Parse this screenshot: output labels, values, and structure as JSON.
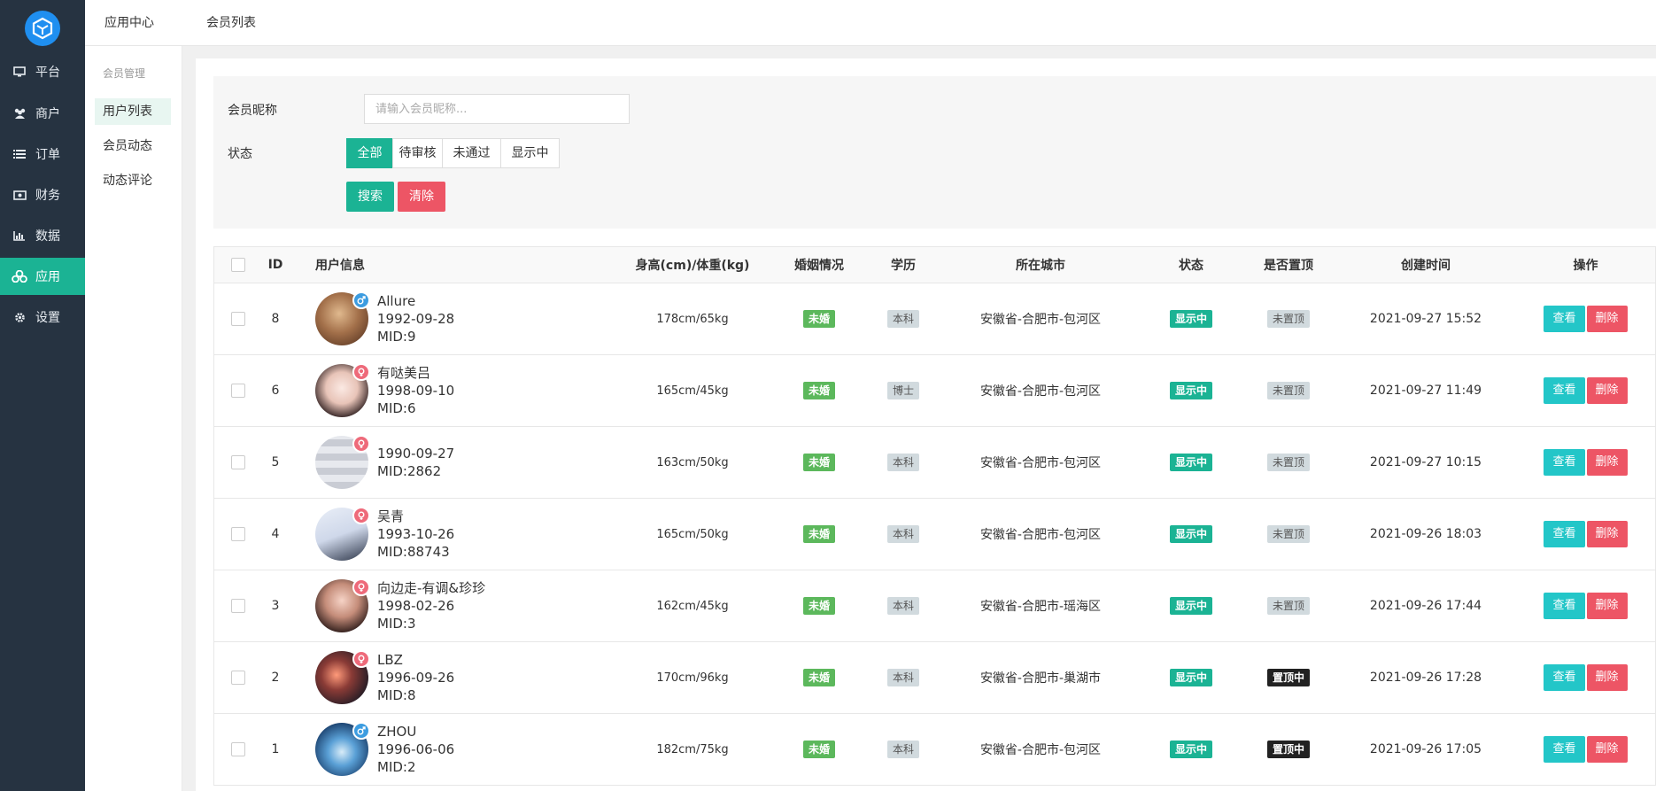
{
  "sidebar": {
    "items": [
      {
        "label": "平台",
        "icon": "monitor-icon",
        "active": false
      },
      {
        "label": "商户",
        "icon": "users-icon",
        "active": false
      },
      {
        "label": "订单",
        "icon": "list-icon",
        "active": false
      },
      {
        "label": "财务",
        "icon": "money-icon",
        "active": false
      },
      {
        "label": "数据",
        "icon": "bar-chart-icon",
        "active": false
      },
      {
        "label": "应用",
        "icon": "cubes-icon",
        "active": true
      },
      {
        "label": "设置",
        "icon": "gear-icon",
        "active": false
      }
    ]
  },
  "topbar": {
    "app_center": "应用中心",
    "member_list": "会员列表"
  },
  "submenu": {
    "title": "会员管理",
    "items": [
      {
        "label": "用户列表",
        "active": true
      },
      {
        "label": "会员动态",
        "active": false
      },
      {
        "label": "动态评论",
        "active": false
      }
    ]
  },
  "filter": {
    "nickname_label": "会员昵称",
    "nickname_placeholder": "请输入会员昵称...",
    "nickname_value": "",
    "status_label": "状态",
    "status_options": [
      "全部",
      "待审核",
      "未通过",
      "显示中"
    ],
    "status_selected": "全部",
    "search_button": "搜索",
    "clear_button": "清除"
  },
  "table": {
    "columns": {
      "id": "ID",
      "user": "用户信息",
      "body": "身高(cm)/体重(kg)",
      "marriage": "婚姻情况",
      "education": "学历",
      "city": "所在城市",
      "status": "状态",
      "pinned": "是否置顶",
      "created": "创建时间",
      "actions": "操作"
    },
    "rows": [
      {
        "id": "8",
        "name": "Allure",
        "birthday": "1992-09-28",
        "mid": "MID:9",
        "gender": "male",
        "body": "178cm/65kg",
        "marriage": "未婚",
        "education": "本科",
        "city": "安徽省-合肥市-包河区",
        "status": "显示中",
        "pinned": "未置顶",
        "created": "2021-09-27 15:52"
      },
      {
        "id": "6",
        "name": "有哒美吕",
        "birthday": "1998-09-10",
        "mid": "MID:6",
        "gender": "female",
        "body": "165cm/45kg",
        "marriage": "未婚",
        "education": "博士",
        "city": "安徽省-合肥市-包河区",
        "status": "显示中",
        "pinned": "未置顶",
        "created": "2021-09-27 11:49"
      },
      {
        "id": "5",
        "name": "",
        "birthday": "1990-09-27",
        "mid": "MID:2862",
        "gender": "female",
        "body": "163cm/50kg",
        "marriage": "未婚",
        "education": "本科",
        "city": "安徽省-合肥市-包河区",
        "status": "显示中",
        "pinned": "未置顶",
        "created": "2021-09-27 10:15"
      },
      {
        "id": "4",
        "name": "吴青",
        "birthday": "1993-10-26",
        "mid": "MID:88743",
        "gender": "female",
        "body": "165cm/50kg",
        "marriage": "未婚",
        "education": "本科",
        "city": "安徽省-合肥市-包河区",
        "status": "显示中",
        "pinned": "未置顶",
        "created": "2021-09-26 18:03"
      },
      {
        "id": "3",
        "name": "向边走-有调&珍珍",
        "birthday": "1998-02-26",
        "mid": "MID:3",
        "gender": "female",
        "body": "162cm/45kg",
        "marriage": "未婚",
        "education": "本科",
        "city": "安徽省-合肥市-瑶海区",
        "status": "显示中",
        "pinned": "未置顶",
        "created": "2021-09-26 17:44"
      },
      {
        "id": "2",
        "name": "LBZ",
        "birthday": "1996-09-26",
        "mid": "MID:8",
        "gender": "female",
        "body": "170cm/96kg",
        "marriage": "未婚",
        "education": "本科",
        "city": "安徽省-合肥市-巢湖市",
        "status": "显示中",
        "pinned": "置顶中",
        "created": "2021-09-26 17:28"
      },
      {
        "id": "1",
        "name": "ZHOU",
        "birthday": "1996-06-06",
        "mid": "MID:2",
        "gender": "male",
        "body": "182cm/75kg",
        "marriage": "未婚",
        "education": "本科",
        "city": "安徽省-合肥市-包河区",
        "status": "显示中",
        "pinned": "置顶中",
        "created": "2021-09-26 17:05"
      }
    ],
    "view_label": "查看",
    "delete_label": "删除"
  },
  "colors": {
    "sidebar_bg": "#263341",
    "accent": "#1bb394",
    "danger": "#ed5565",
    "info": "#23c6c8"
  }
}
